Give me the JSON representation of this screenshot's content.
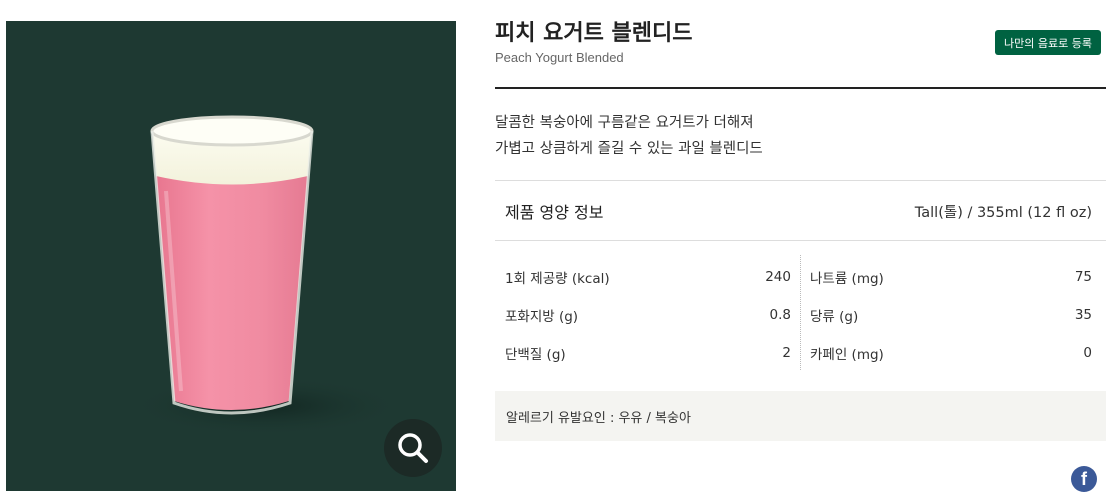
{
  "product": {
    "name_ko": "피치 요거트 블렌디드",
    "name_en": "Peach Yogurt Blended",
    "register_button": "나만의 음료로 등록",
    "description": [
      "달콤한 복숭아에 구름같은 요거트가 더해져",
      "가볍고 상큼하게 즐길 수 있는 과일 블렌디드"
    ]
  },
  "nutrition": {
    "heading": "제품 영양 정보",
    "size": "Tall(톨) / 355ml (12 fl oz)",
    "left": [
      {
        "label": "1회 제공량 (kcal)",
        "value": "240"
      },
      {
        "label": "포화지방 (g)",
        "value": "0.8"
      },
      {
        "label": "단백질 (g)",
        "value": "2"
      }
    ],
    "right": [
      {
        "label": "나트륨 (mg)",
        "value": "75"
      },
      {
        "label": "당류 (g)",
        "value": "35"
      },
      {
        "label": "카페인 (mg)",
        "value": "0"
      }
    ]
  },
  "allergy": "알레르기 유발요인 : 우유 / 복숭아",
  "icons": {
    "zoom": "search-icon",
    "share": "facebook-icon"
  },
  "colors": {
    "brand_green": "#006241",
    "image_bg": "#1e3932",
    "drink_pink": "#f08aa0"
  }
}
